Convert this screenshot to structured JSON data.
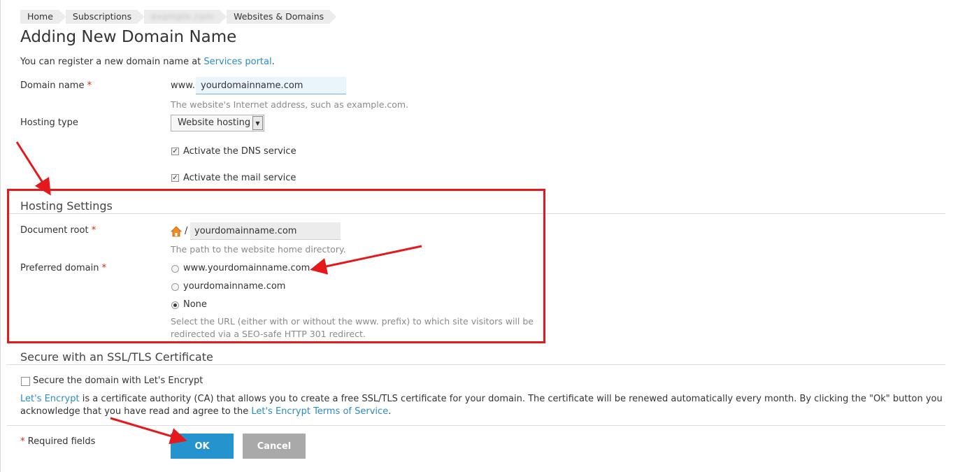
{
  "breadcrumbs": [
    "Home",
    "Subscriptions",
    "example.com",
    "Websites & Domains"
  ],
  "page_title": "Adding New Domain Name",
  "intro": {
    "text_before": "You can register a new domain name at ",
    "link": "Services portal",
    "text_after": "."
  },
  "form": {
    "domain_name": {
      "label": "Domain name",
      "required_mark": "*",
      "prefix": "www.",
      "value": "yourdomainname.com",
      "hint": "The website's Internet address, such as example.com."
    },
    "hosting_type": {
      "label": "Hosting type",
      "selected": "Website hosting"
    },
    "dns_service": {
      "label": "Activate the DNS service",
      "checked": true
    },
    "mail_service": {
      "label": "Activate the mail service",
      "checked": true
    }
  },
  "hosting_settings": {
    "title": "Hosting Settings",
    "document_root": {
      "label": "Document root",
      "required_mark": "*",
      "separator": "/",
      "value": "yourdomainname.com",
      "hint": "The path to the website home directory."
    },
    "preferred_domain": {
      "label": "Preferred domain",
      "required_mark": "*",
      "options": [
        "www.yourdomainname.com",
        "yourdomainname.com",
        "None"
      ],
      "selected": "None",
      "hint_line1": "Select the URL (either with or without the www. prefix) to which site visitors will be",
      "hint_line2": "redirected via a SEO-safe HTTP 301 redirect."
    }
  },
  "ssl": {
    "title": "Secure with an SSL/TLS Certificate",
    "checkbox_label": "Secure the domain with Let's Encrypt",
    "checked": false,
    "para_link1": "Let's Encrypt",
    "para_text": " is a certificate authority (CA) that allows you to create a free SSL/TLS certificate for your domain. The certificate will be renewed automatically every month. By clicking the \"Ok\" button you acknowledge that you have read and agree to the ",
    "para_link2": "Let's Encrypt Terms of Service",
    "para_end": "."
  },
  "footer": {
    "required_mark": "*",
    "required_text": " Required fields",
    "ok_label": "OK",
    "cancel_label": "Cancel"
  },
  "colors": {
    "accent": "#2593cd",
    "link": "#2a8bc4",
    "annotation": "#e5191c",
    "required": "#d9230f"
  },
  "icons": [
    "home-folder-icon",
    "dropdown-arrow-icon",
    "checkmark-icon"
  ]
}
